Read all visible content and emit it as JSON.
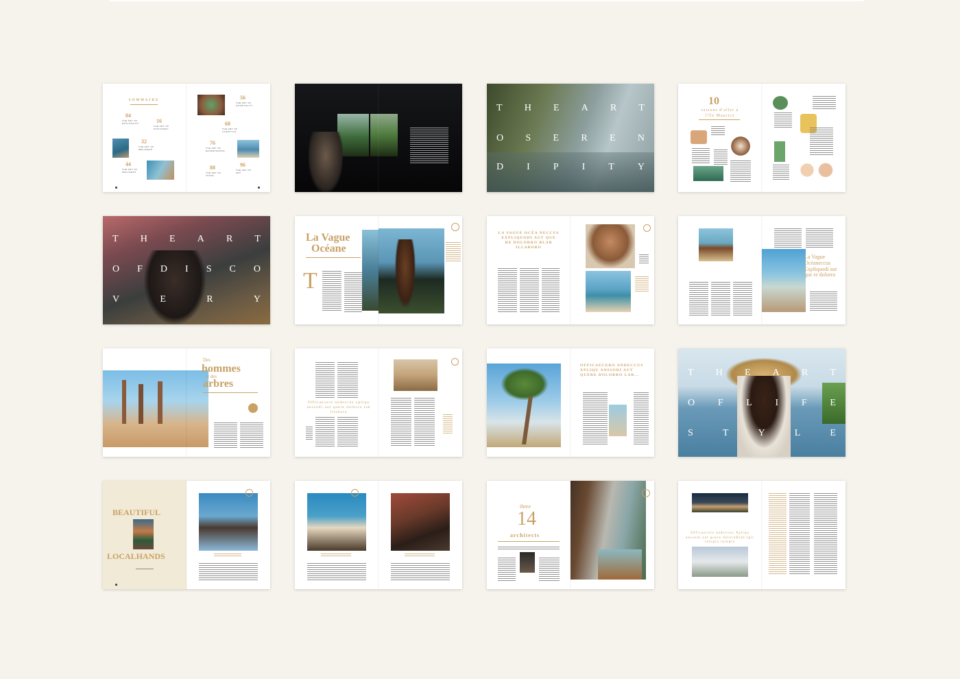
{
  "sommaire": {
    "title": "SOMMAIRE",
    "items": [
      {
        "num": "04",
        "text": "THE ART OF\nEXCLUSIVITY"
      },
      {
        "num": "16",
        "text": "THE ART OF\nDISCOVERY"
      },
      {
        "num": "32",
        "text": "THE ART OF\nWELLNESS"
      },
      {
        "num": "44",
        "text": "THE ART OF\nWELLNESS"
      },
      {
        "num": "56",
        "text": "THE ART OF\nHOSPITALITY"
      },
      {
        "num": "68",
        "text": "THE ART OF\nLIFESTYLE"
      },
      {
        "num": "76",
        "text": "THE ART OF\nENTERTAINING"
      },
      {
        "num": "88",
        "text": "THE ART OF\nTASTE"
      },
      {
        "num": "96",
        "text": "THE ART OF\nART"
      }
    ]
  },
  "serendipity": {
    "row1": [
      "T",
      "H",
      "E",
      "A",
      "R",
      "T"
    ],
    "row2": [
      "O",
      "S",
      "E",
      "R",
      "E",
      "N"
    ],
    "row3": [
      "D",
      "I",
      "P",
      "I",
      "T",
      "Y"
    ]
  },
  "ten": {
    "num": "10",
    "sub": "raisons d'aller à l'île Maurice"
  },
  "discovery": {
    "row1": [
      "T",
      "H",
      "E",
      "A",
      "R",
      "T"
    ],
    "row2": [
      "O",
      "F",
      "D",
      "I",
      "S",
      "C",
      "O"
    ],
    "row3": [
      "V",
      "E",
      "R",
      "Y"
    ]
  },
  "vague": {
    "title1": "La Vague",
    "title2": "Océane",
    "dropcap": "T"
  },
  "vague2": {
    "heading": "LA VAGUE OCÉA NECCUS EXPLIQUODI AUT QUE RE DOLORRO BLAB ILLABORO"
  },
  "vague3": {
    "heading": "La Vague Océaneccus Expliquodi aut que re dolorro"
  },
  "arbres": {
    "line1": "Des",
    "line2": "hommes",
    "line3": "et des",
    "line4": "arbres"
  },
  "officia1": {
    "heading": "Officaecero andeccus xpliqu anssodi aut quere dolorro lab illabora"
  },
  "officia2": {
    "heading": "OFFICAECERO ANDECCUS XPLIQU ANSSODI AUT QUERE DOLORRO LAB..."
  },
  "style": {
    "row1": [
      "T",
      "H",
      "E",
      "A",
      "R",
      "T"
    ],
    "row2": [
      "O",
      "F",
      "L",
      "I",
      "F",
      "E"
    ],
    "row3": [
      "S",
      "T",
      "Y",
      "L",
      "E"
    ]
  },
  "local": {
    "line1": "BEAUTIFUL",
    "line2": "LOCALHANDS"
  },
  "architects": {
    "pre": "three",
    "num": "14",
    "post": "architects"
  },
  "archtext": {
    "heading": "Officaecero andeccus Xpliqu anssodi aut quere doloroBlab Igit talupta turepta"
  }
}
